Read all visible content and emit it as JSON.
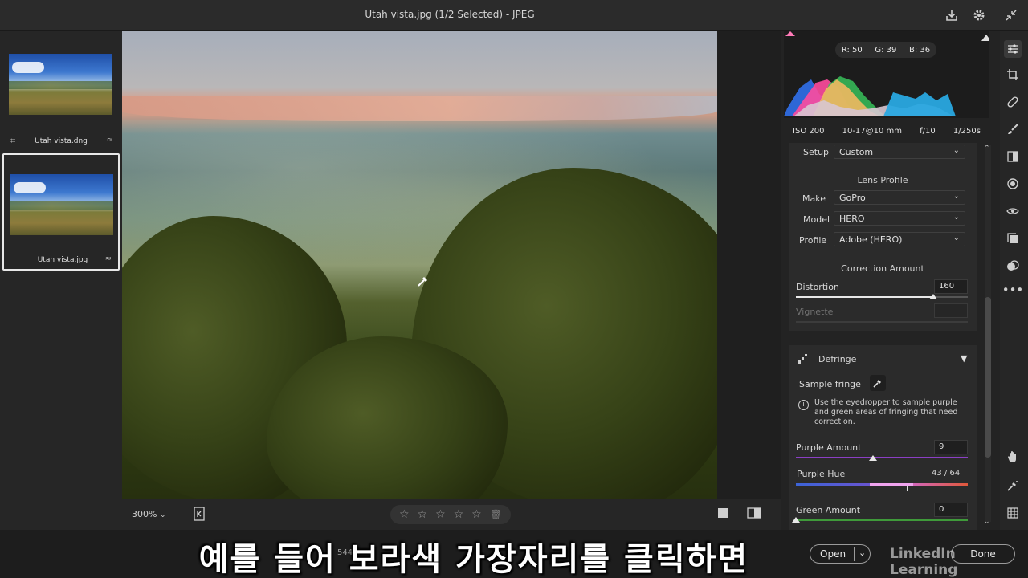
{
  "window": {
    "title": "Utah vista.jpg (1/2 Selected)  -  JPEG",
    "icons": [
      "save-icon",
      "gear-icon",
      "collapse-icon"
    ]
  },
  "filmstrip": {
    "items": [
      {
        "filename": "Utah vista.dng",
        "selected": false
      },
      {
        "filename": "Utah vista.jpg",
        "selected": true
      }
    ]
  },
  "viewer": {
    "zoom": "300%",
    "rating_stars": 0
  },
  "histogram": {
    "r": "R: 50",
    "g": "G: 39",
    "b": "B: 36"
  },
  "exif": {
    "iso": "ISO 200",
    "lens": "10-17@10 mm",
    "aperture": "f/10",
    "shutter": "1/250s"
  },
  "lens_corrections": {
    "setup_label": "Setup",
    "setup_value": "Custom",
    "lens_profile_heading": "Lens Profile",
    "make_label": "Make",
    "make_value": "GoPro",
    "model_label": "Model",
    "model_value": "HERO",
    "profile_label": "Profile",
    "profile_value": "Adobe (HERO)",
    "correction_heading": "Correction Amount",
    "distortion_label": "Distortion",
    "distortion_value": "160",
    "distortion_fraction": 0.8,
    "vignette_label": "Vignette",
    "vignette_value": ""
  },
  "defringe": {
    "title": "Defringe",
    "sample_label": "Sample fringe",
    "info": "Use the eyedropper to sample purple and green areas of fringing that need correction.",
    "purple_amount_label": "Purple Amount",
    "purple_amount_value": "9",
    "purple_amount_fraction": 0.45,
    "purple_hue_label": "Purple Hue",
    "purple_hue_value": "43 / 64",
    "green_amount_label": "Green Amount",
    "green_amount_value": "0"
  },
  "footer": {
    "meta": "5440",
    "open_label": "Open",
    "done_label": "Done",
    "watermark": "LinkedIn Learning",
    "subtitle": "예를 들어 보라색 가장자리를 클릭하면"
  },
  "colors": {
    "purple_track": "#8b3fc4",
    "green_track": "#3f9a3a",
    "hue_gradient": [
      "#3c64d8",
      "#6a54d0",
      "#cf6bd9",
      "#e0583a"
    ]
  }
}
